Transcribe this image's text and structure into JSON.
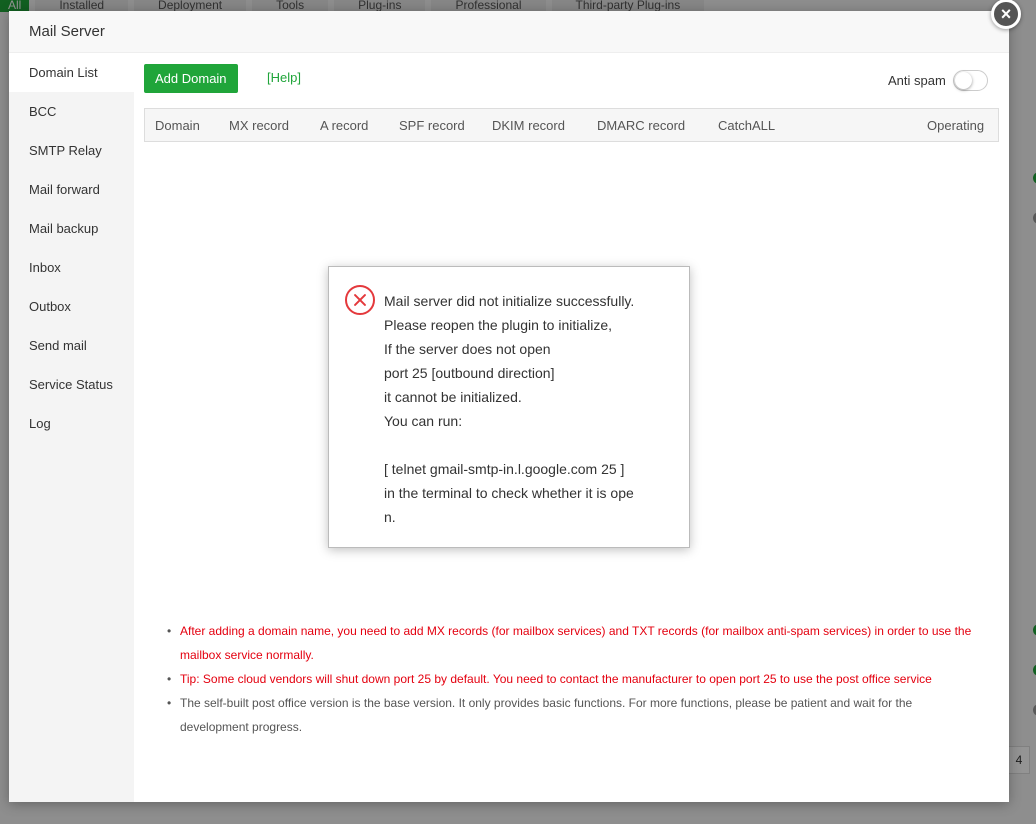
{
  "background": {
    "tabs": [
      "All",
      "Installed",
      "Deployment",
      "Tools",
      "Plug-ins",
      "Professional",
      "Third-party Plug-ins"
    ],
    "page_number": "4"
  },
  "modal": {
    "title": "Mail Server",
    "close_symbol": "×"
  },
  "sidebar": {
    "items": [
      {
        "label": "Domain List"
      },
      {
        "label": "BCC"
      },
      {
        "label": "SMTP Relay"
      },
      {
        "label": "Mail forward"
      },
      {
        "label": "Mail backup"
      },
      {
        "label": "Inbox"
      },
      {
        "label": "Outbox"
      },
      {
        "label": "Send mail"
      },
      {
        "label": "Service Status"
      },
      {
        "label": "Log"
      }
    ]
  },
  "toolbar": {
    "add_domain": "Add Domain",
    "help": "[Help]",
    "anti_spam": "Anti spam",
    "anti_spam_enabled": false
  },
  "table": {
    "columns": [
      "Domain",
      "MX record",
      "A record",
      "SPF record",
      "DKIM record",
      "DMARC record",
      "CatchALL",
      "Operating"
    ]
  },
  "notes": [
    {
      "type": "red",
      "text": "After adding a domain name, you need to add MX records (for mailbox services) and TXT records (for mailbox anti-spam services) in order to use the mailbox service normally."
    },
    {
      "type": "red",
      "text": "Tip: Some cloud vendors will shut down port 25 by default. You need to contact the manufacturer to open port 25 to use the post office service"
    },
    {
      "type": "grey",
      "text": "The self-built post office version is the base version. It only provides basic functions. For more functions, please be patient and wait for the development progress."
    }
  ],
  "dialog": {
    "lines": [
      "Mail server did not initialize successfully.",
      "Please reopen the plugin to initialize,",
      "If the server does not open",
      "port 25 [outbound direction]",
      "it cannot be initialized.",
      "You can run:",
      "",
      "[ telnet gmail-smtp-in.l.google.com 25 ]",
      "in the terminal to check whether it is ope",
      "n."
    ]
  },
  "colors": {
    "accent": "#20a53a",
    "error": "#e4393c",
    "note_red": "#e4000f"
  }
}
